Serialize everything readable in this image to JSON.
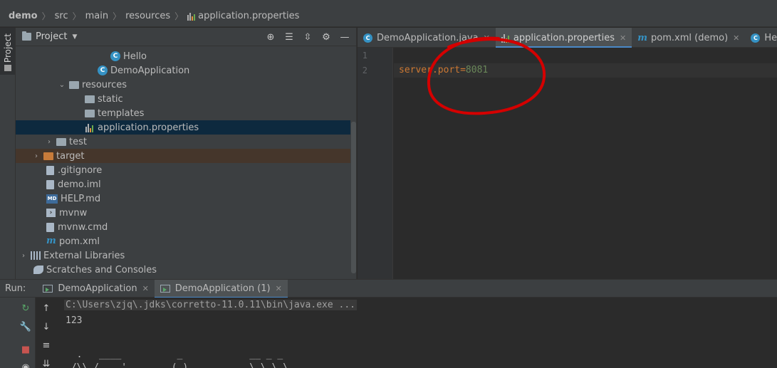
{
  "breadcrumb": {
    "items": [
      "demo",
      "src",
      "main",
      "resources"
    ],
    "file": "application.properties"
  },
  "left_strip": {
    "project_tab": "Project"
  },
  "project_panel": {
    "title": "Project",
    "tree": [
      {
        "label": "Hello",
        "icon": "java-class-icon"
      },
      {
        "label": "DemoApplication",
        "icon": "spring-class-icon"
      },
      {
        "label": "resources",
        "icon": "resources-folder-icon",
        "expanded": true
      },
      {
        "label": "static",
        "icon": "folder-icon"
      },
      {
        "label": "templates",
        "icon": "folder-icon"
      },
      {
        "label": "application.properties",
        "icon": "properties-file-icon",
        "selected": true
      },
      {
        "label": "test",
        "icon": "folder-icon",
        "expanded": false
      },
      {
        "label": "target",
        "icon": "excluded-folder-icon",
        "expanded": false
      },
      {
        "label": ".gitignore",
        "icon": "gitignore-file-icon"
      },
      {
        "label": "demo.iml",
        "icon": "iml-file-icon"
      },
      {
        "label": "HELP.md",
        "icon": "markdown-file-icon"
      },
      {
        "label": "mvnw",
        "icon": "shell-script-icon"
      },
      {
        "label": "mvnw.cmd",
        "icon": "cmd-file-icon"
      },
      {
        "label": "pom.xml",
        "icon": "maven-icon"
      },
      {
        "label": "External Libraries",
        "icon": "libraries-icon",
        "expanded": false
      },
      {
        "label": "Scratches and Consoles",
        "icon": "scratches-icon"
      }
    ]
  },
  "editor": {
    "tabs": [
      {
        "label": "DemoApplication.java",
        "active": false
      },
      {
        "label": "application.properties",
        "active": true
      },
      {
        "label": "pom.xml (demo)",
        "active": false
      },
      {
        "label": "Hello.java",
        "active": false
      }
    ],
    "line_numbers": [
      "1",
      "2"
    ],
    "code": {
      "key": "server.port",
      "eq": "=",
      "value": "8081"
    }
  },
  "run_panel": {
    "label": "Run:",
    "tabs": [
      {
        "label": "DemoApplication",
        "active": false
      },
      {
        "label": "DemoApplication (1)",
        "active": true
      }
    ],
    "console_lines": [
      "C:\\Users\\zjq\\.jdks\\corretto-11.0.11\\bin\\java.exe ...",
      "123",
      "",
      "  .   ____          _            __ _ _",
      " /\\\\ / ___'_ __ _ _(_)_ __  __ _ \\ \\ \\ \\"
    ]
  },
  "colors": {
    "accent": "#4a88c7",
    "selection": "#0d293e",
    "annotation": "#d40000"
  }
}
